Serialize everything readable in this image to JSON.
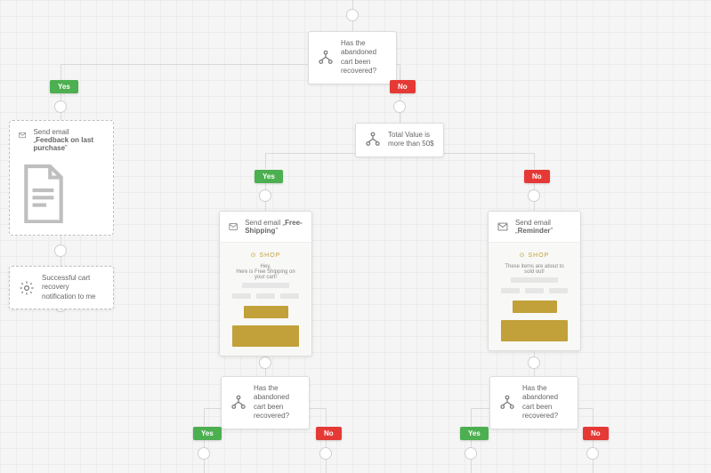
{
  "labels": {
    "yes": "Yes",
    "no": "No"
  },
  "nodes": {
    "condition_root": "Has the abandoned cart been recovered?",
    "feedback": {
      "prefix": "Send email „",
      "bold": "Feedback on last purchase",
      "suffix": "”"
    },
    "notify": "Successful cart recovery notification to me",
    "value_condition": "Total Value is more than 50$",
    "email_freeshipping": {
      "prefix": "Send email „",
      "bold": "Free-Shipping",
      "suffix": "”"
    },
    "email_reminder": {
      "prefix": "Send email „",
      "bold": "Reminder",
      "suffix": "”"
    },
    "preview_hey": "Hey,",
    "preview_freeship_line": "Here is Free Shipping on your cart!",
    "preview_reminder_line": "These items are about to sold out!",
    "logo": "⊙ SHOP",
    "condition_again": "Has the abandoned cart been recovered?"
  }
}
